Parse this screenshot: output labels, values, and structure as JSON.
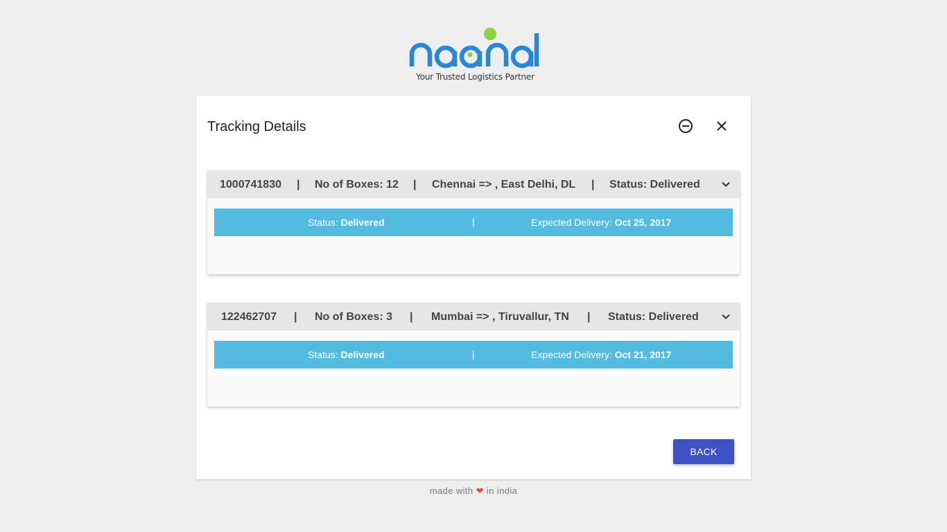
{
  "logo": {
    "wordmark": "naanal",
    "tagline": "Your Trusted Logistics Partner",
    "colors": {
      "primary": "#2a86d6",
      "accent": "#8fd13f"
    }
  },
  "card": {
    "title": "Tracking Details",
    "icons": {
      "minimize": "minus-circle-icon",
      "close": "close-icon"
    }
  },
  "shipments": [
    {
      "id": "1000741830",
      "boxes": "No of Boxes: 12",
      "route": "Chennai => , East Delhi, DL",
      "status": "Status: Delivered",
      "detail": {
        "status_label": "Status:",
        "status_value": "Delivered",
        "separator": "|",
        "delivery_label": "Expected Delivery:",
        "delivery_value": "Oct 25, 2017"
      }
    },
    {
      "id": "122462707",
      "boxes": "No of Boxes: 3",
      "route": "Mumbai => , Tiruvallur, TN",
      "status": "Status: Delivered",
      "detail": {
        "status_label": "Status:",
        "status_value": "Delivered",
        "separator": "|",
        "delivery_label": "Expected Delivery:",
        "delivery_value": "Oct 21, 2017"
      }
    }
  ],
  "header_separator": "|",
  "actions": {
    "back_label": "BACK"
  },
  "footer": {
    "before": "made with",
    "heart": "❤",
    "after": "in india"
  },
  "colors": {
    "status_bar": "#53bbe0",
    "button": "#3f51c5",
    "heart": "#e8493f"
  }
}
